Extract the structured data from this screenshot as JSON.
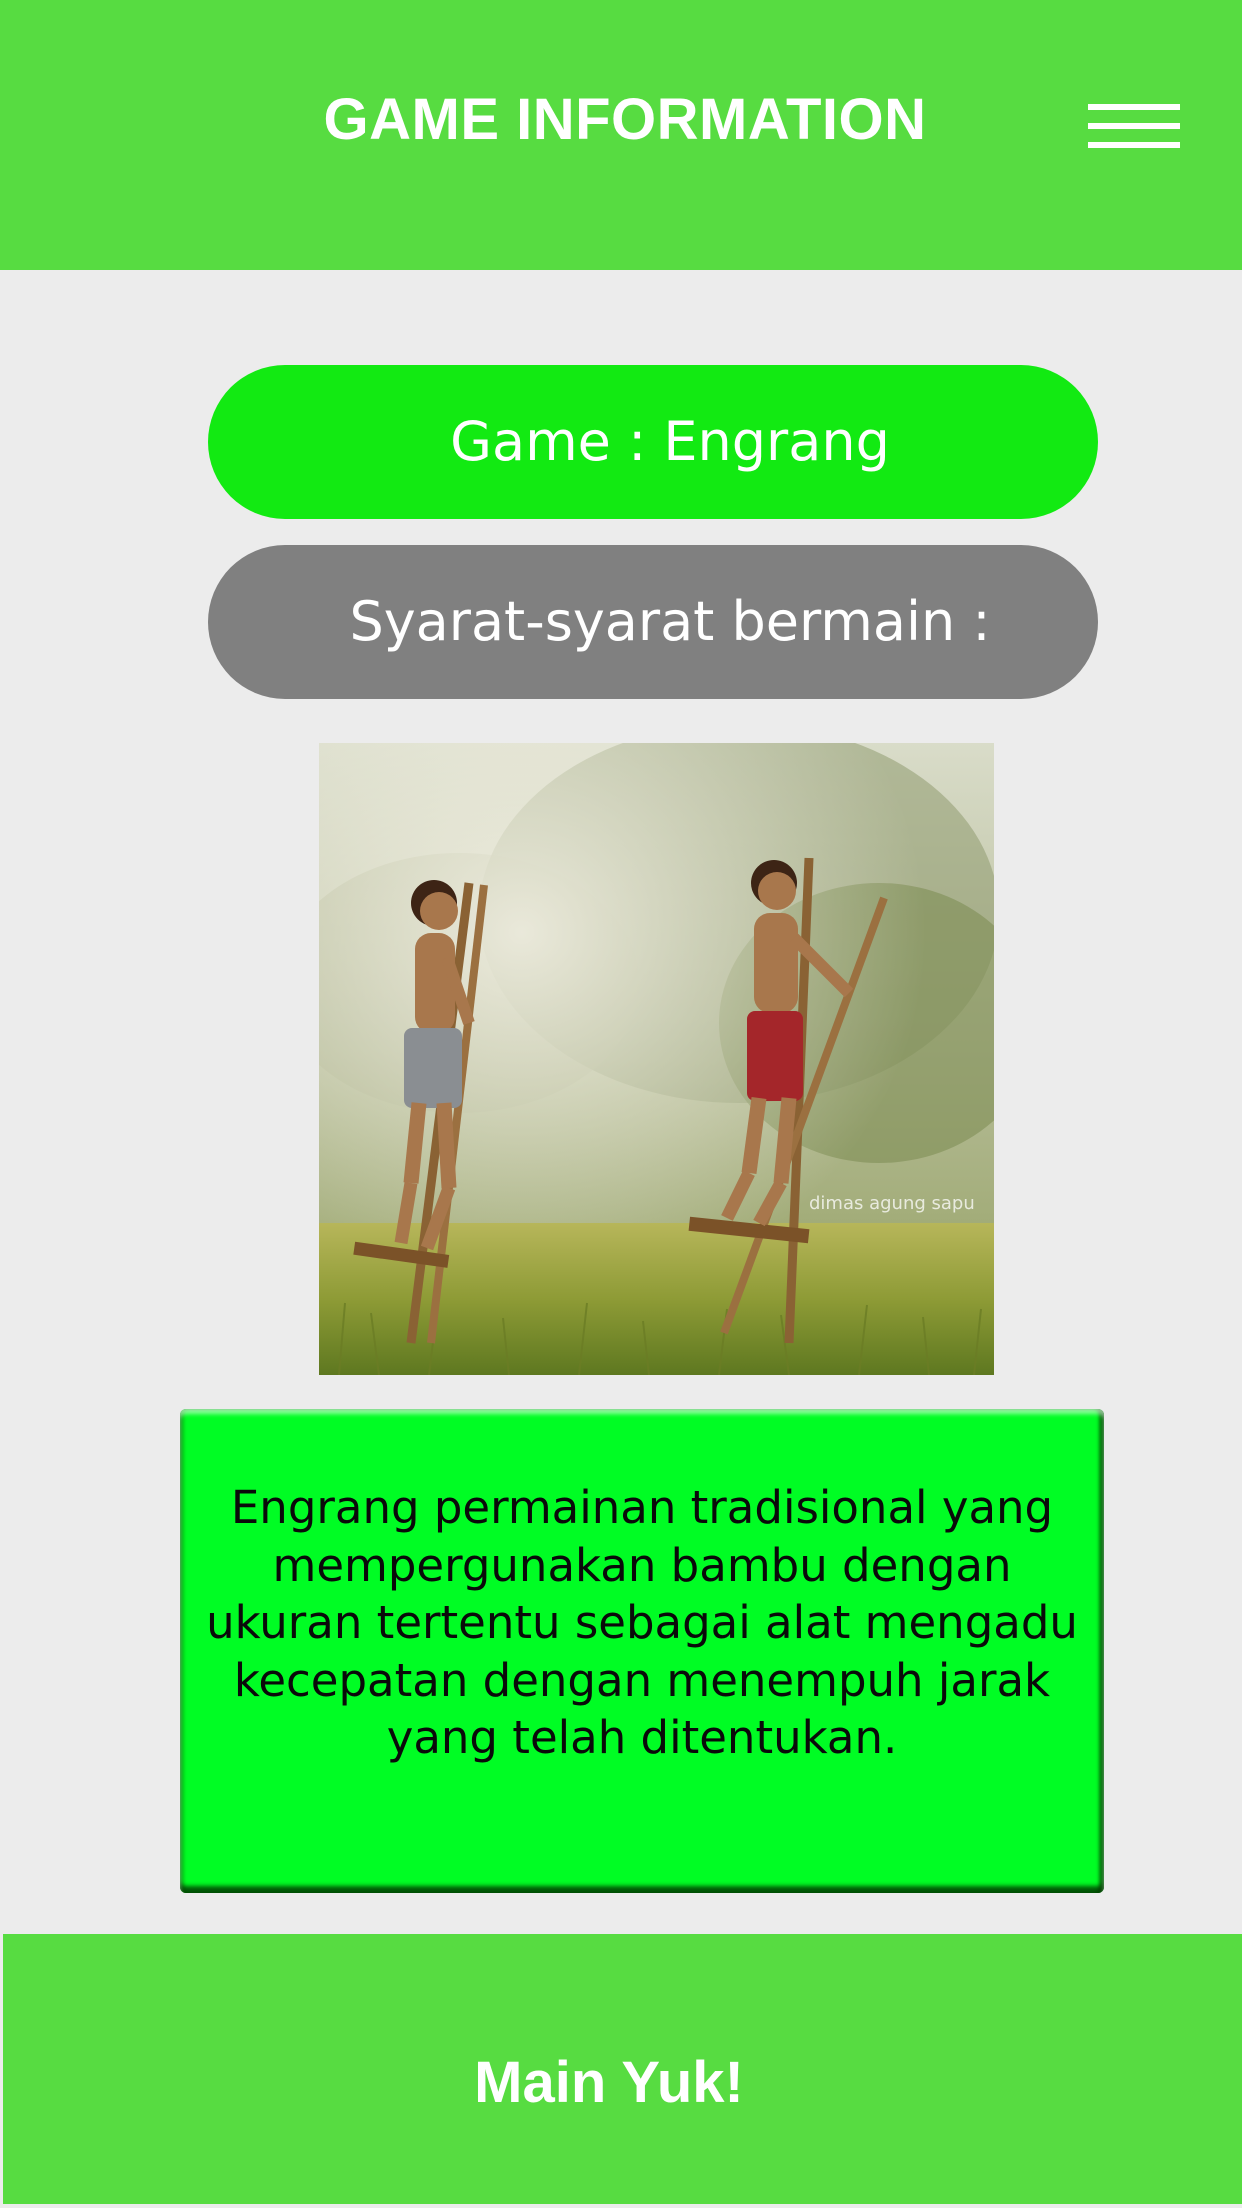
{
  "header": {
    "title": "GAME INFORMATION",
    "menu_icon": "hamburger-menu-icon"
  },
  "game": {
    "title": "Game : Engrang",
    "requirements_label": "Syarat-syarat bermain :"
  },
  "image": {
    "watermark": "dimas agung sapu"
  },
  "description": {
    "text": "Engrang permainan tradisional yang mempergunakan bambu dengan ukuran tertentu sebagai alat mengadu kecepatan dengan menempuh jarak yang telah ditentukan."
  },
  "action": {
    "play_label": "Main Yuk!"
  },
  "colors": {
    "header_green": "#57dc41",
    "pill_green": "#12ea12",
    "pill_gray": "#808080",
    "description_green": "#00fd24",
    "background": "#ececec"
  }
}
